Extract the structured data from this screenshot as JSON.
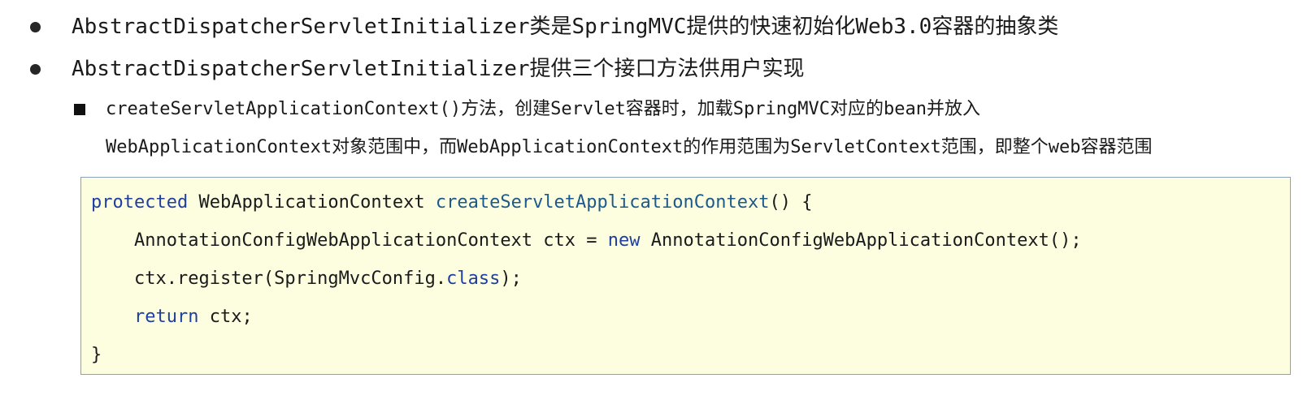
{
  "bullets": [
    "AbstractDispatcherServletInitializer类是SpringMVC提供的快速初始化Web3.0容器的抽象类",
    "AbstractDispatcherServletInitializer提供三个接口方法供用户实现"
  ],
  "sub_bullet": {
    "line1": "createServletApplicationContext()方法，创建Servlet容器时，加载SpringMVC对应的bean并放入",
    "line2": "WebApplicationContext对象范围中，而WebApplicationContext的作用范围为ServletContext范围，即整个web容器范围"
  },
  "code": {
    "l1_kw": "protected",
    "l1_type": " WebApplicationContext ",
    "l1_fn": "createServletApplicationContext",
    "l1_rest": "() {",
    "l2_a": "    AnnotationConfigWebApplicationContext ctx = ",
    "l2_kw": "new",
    "l2_b": " AnnotationConfigWebApplicationContext();",
    "l3_a": "    ctx.register(SpringMvcConfig.",
    "l3_kw": "class",
    "l3_b": ");",
    "l4_indent": "    ",
    "l4_kw": "return",
    "l4_b": " ctx;",
    "l5": "}"
  }
}
